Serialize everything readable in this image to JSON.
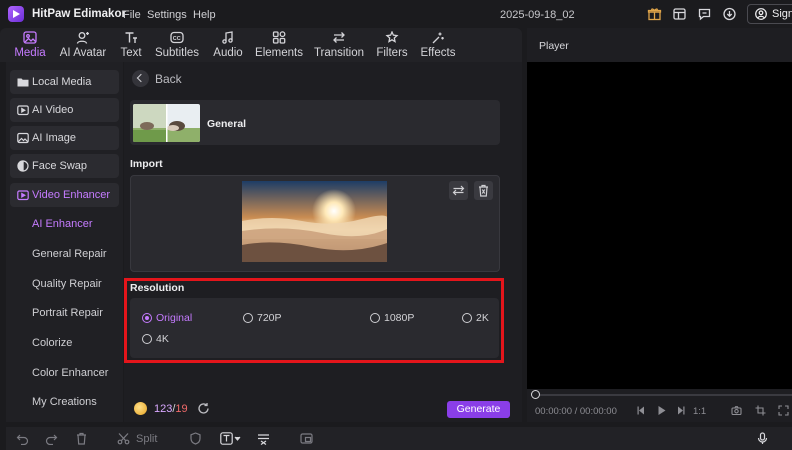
{
  "app": {
    "name": "HitPaw Edimakor",
    "document_title": "2025-09-18_02"
  },
  "menu": [
    "File",
    "Settings",
    "Help"
  ],
  "title_icons": [
    "gift-icon",
    "layout-icon",
    "feedback-icon",
    "download-icon"
  ],
  "sign_in": {
    "label": "Sign"
  },
  "tabs": [
    {
      "label": "Media",
      "icon": "media-icon",
      "active": true
    },
    {
      "label": "AI Avatar",
      "icon": "ai-avatar-icon",
      "active": false
    },
    {
      "label": "Text",
      "icon": "text-icon",
      "active": false
    },
    {
      "label": "Subtitles",
      "icon": "subtitles-icon",
      "active": false
    },
    {
      "label": "Audio",
      "icon": "audio-icon",
      "active": false
    },
    {
      "label": "Elements",
      "icon": "elements-icon",
      "active": false
    },
    {
      "label": "Transition",
      "icon": "transition-icon",
      "active": false
    },
    {
      "label": "Filters",
      "icon": "filters-icon",
      "active": false
    },
    {
      "label": "Effects",
      "icon": "effects-icon",
      "active": false
    }
  ],
  "sidebar": {
    "items": [
      {
        "label": "Local Media",
        "icon": "folder-icon"
      },
      {
        "label": "AI Video",
        "icon": "ai-video-icon"
      },
      {
        "label": "AI Image",
        "icon": "ai-image-icon"
      },
      {
        "label": "Face Swap",
        "icon": "face-swap-icon"
      },
      {
        "label": "Video Enhancer",
        "icon": "video-enhancer-icon",
        "active": true
      }
    ],
    "sub_items": [
      {
        "label": "AI Enhancer",
        "active": true
      },
      {
        "label": "General Repair"
      },
      {
        "label": "Quality Repair"
      },
      {
        "label": "Portrait Repair"
      },
      {
        "label": "Colorize"
      },
      {
        "label": "Color Enhancer"
      },
      {
        "label": "My Creations"
      }
    ]
  },
  "panel": {
    "back_label": "Back",
    "model_label": "General",
    "import_label": "Import",
    "resolution_label": "Resolution",
    "resolutions": [
      {
        "label": "Original",
        "checked": true
      },
      {
        "label": "720P",
        "checked": false
      },
      {
        "label": "1080P",
        "checked": false
      },
      {
        "label": "2K",
        "checked": false
      },
      {
        "label": "4K",
        "checked": false
      }
    ],
    "credits_used": "123",
    "credits_sep": "/",
    "credits_cost": "19",
    "generate_label": "Generate"
  },
  "player": {
    "title": "Player",
    "timecode": "00:00:00 / 00:00:00",
    "speed": "1:1"
  },
  "bottombar": {
    "split_label": "Split"
  },
  "colors": {
    "accent": "#c57bff",
    "generate": "#8a3ee8",
    "highlight": "#e4151b"
  }
}
